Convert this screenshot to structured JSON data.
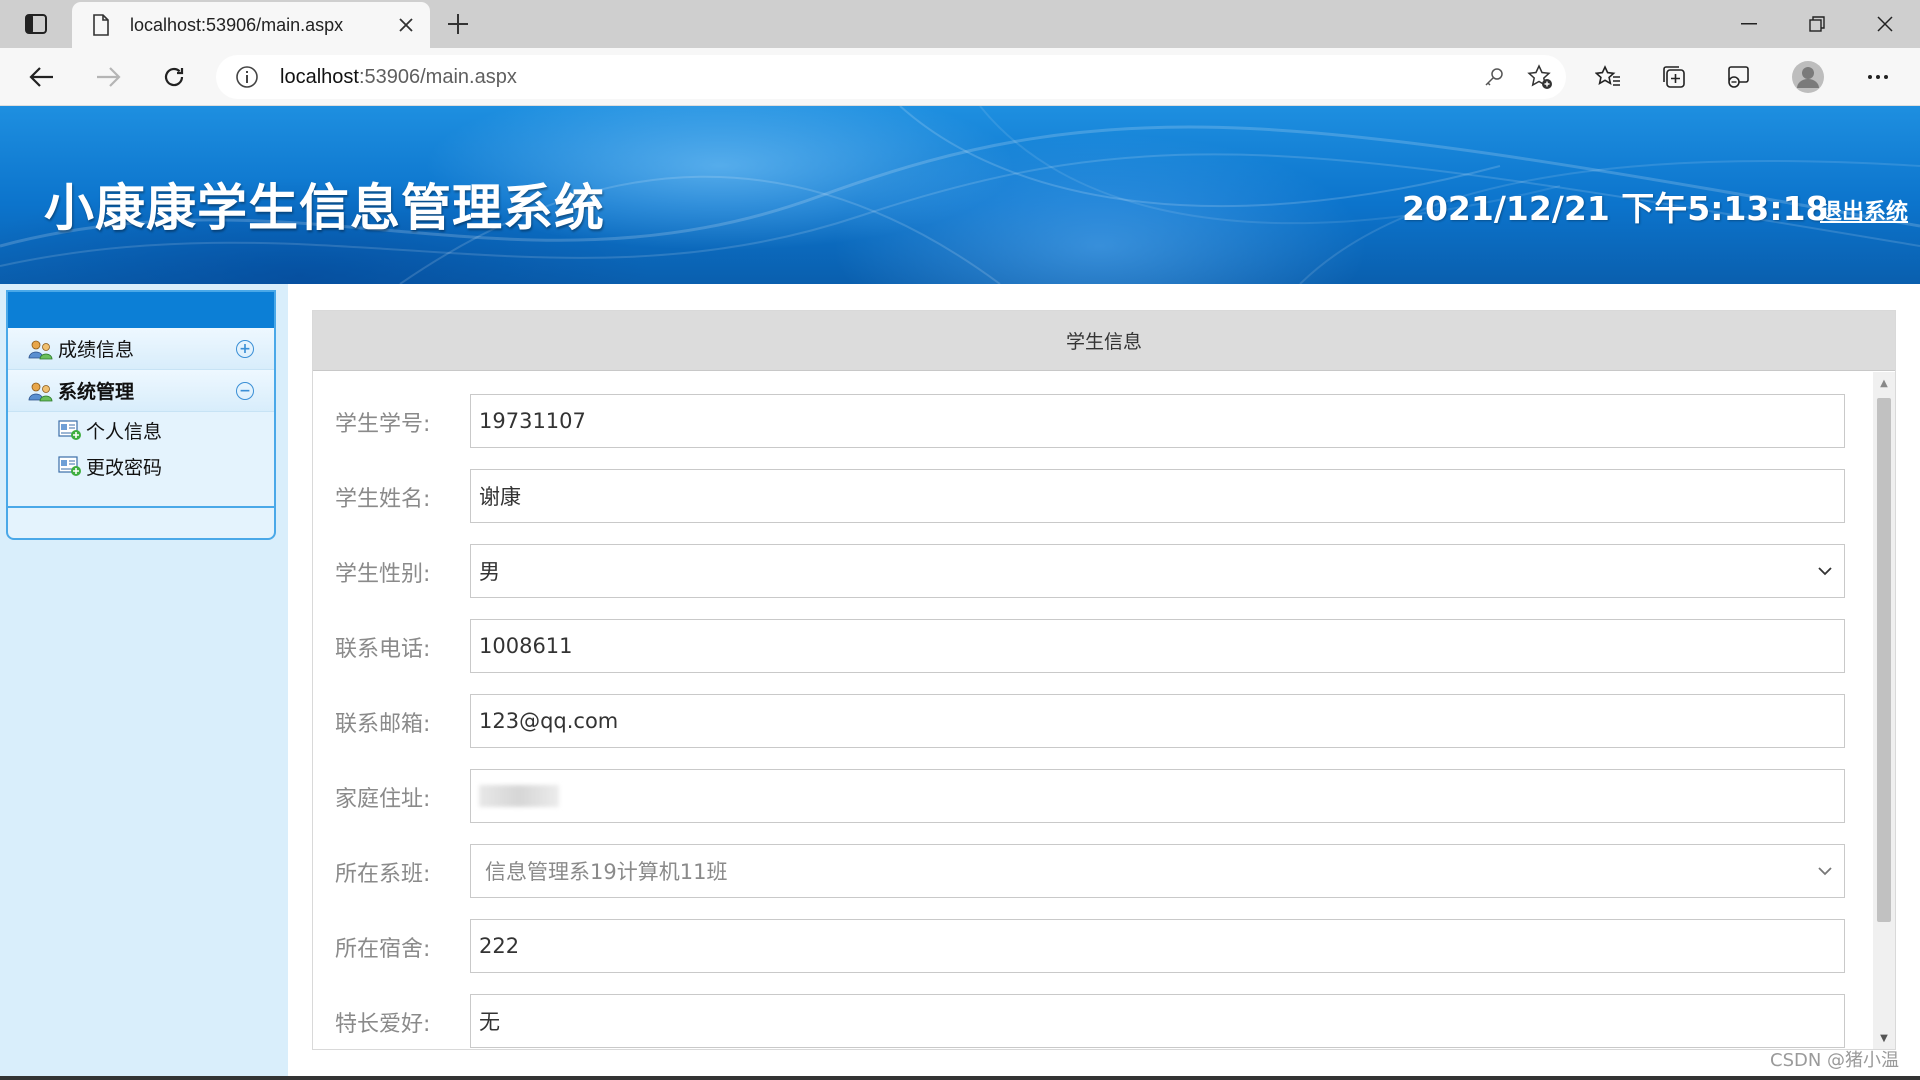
{
  "browser": {
    "tab_title": "localhost:53906/main.aspx",
    "url_host": "localhost",
    "url_rest": ":53906/main.aspx"
  },
  "header": {
    "title": "小康康学生信息管理系统",
    "clock": "2021/12/21 下午5:13:18",
    "logout_label": "退出系统"
  },
  "sidebar": {
    "groups": [
      {
        "label": "成绩信息",
        "toggle": "+"
      },
      {
        "label": "系统管理",
        "toggle": "−"
      }
    ],
    "sub_items": [
      {
        "label": "个人信息"
      },
      {
        "label": "更改密码"
      }
    ]
  },
  "form": {
    "title": "学生信息",
    "fields": [
      {
        "label": "学生学号:",
        "value": "19731107",
        "type": "text"
      },
      {
        "label": "学生姓名:",
        "value": "谢康",
        "type": "text"
      },
      {
        "label": "学生性别:",
        "value": "男",
        "type": "select"
      },
      {
        "label": "联系电话:",
        "value": "1008611",
        "type": "text"
      },
      {
        "label": "联系邮箱:",
        "value": "123@qq.com",
        "type": "text"
      },
      {
        "label": "家庭住址:",
        "value": "",
        "type": "text-redacted"
      },
      {
        "label": "所在系班:",
        "value": "信息管理系19计算机11班",
        "type": "select-disabled"
      },
      {
        "label": "所在宿舍:",
        "value": "222",
        "type": "text"
      },
      {
        "label": "特长爱好:",
        "value": "无",
        "type": "text"
      }
    ]
  },
  "watermark": "CSDN @猪小温",
  "colors": {
    "banner_blue": "#0c74cc",
    "sidebar_bg": "#d9eefb",
    "menu_head": "#0c7fd6"
  }
}
